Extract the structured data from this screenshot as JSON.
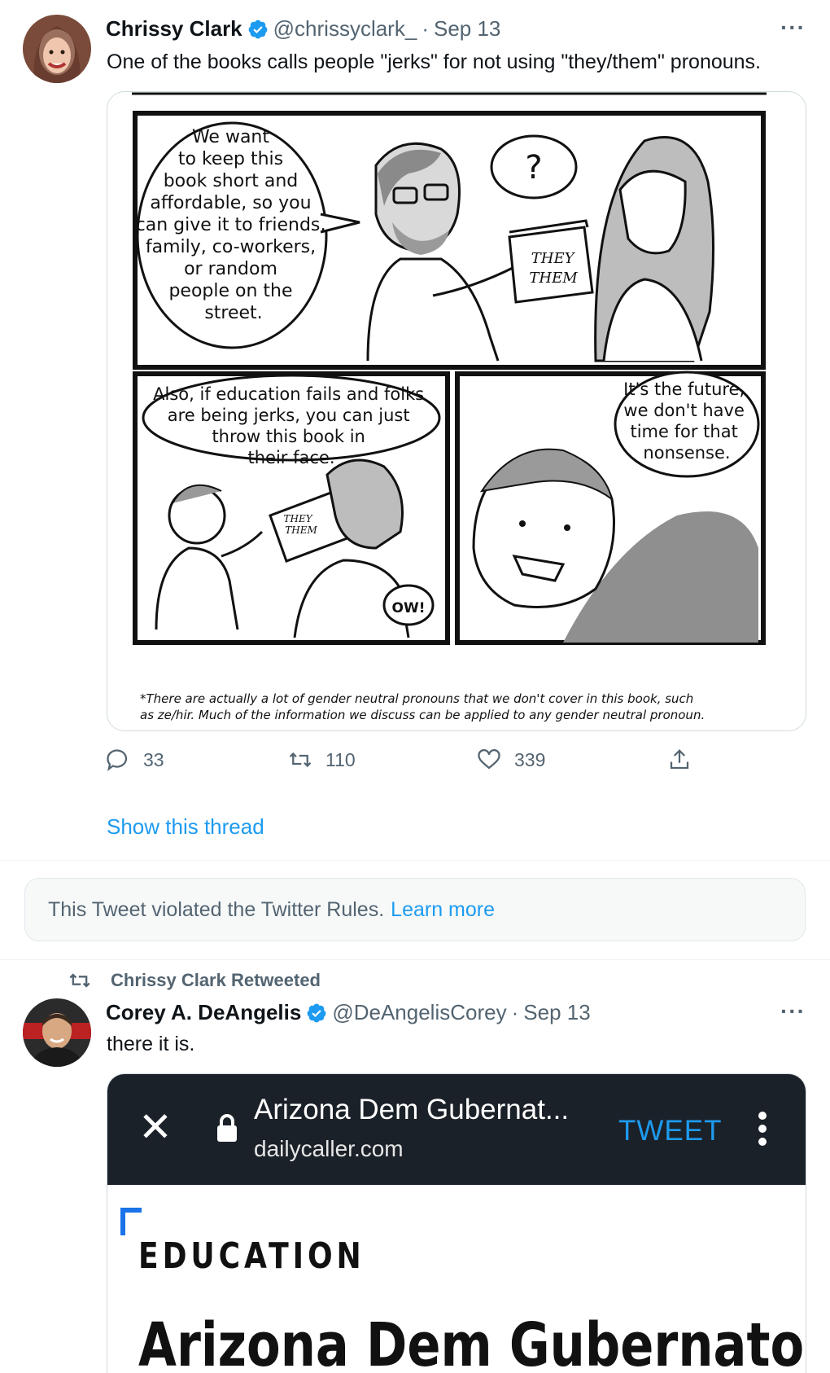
{
  "tweet1": {
    "author_name": "Chrissy Clark",
    "handle": "@chrissyclark_",
    "separator": "·",
    "date": "Sep 13",
    "more": "···",
    "text": "One of the books calls people \"jerks\" for not using \"they/them\" pronouns.",
    "comic": {
      "panel1_bubble": [
        "We want",
        "to keep this",
        "book short and",
        "affordable, so you",
        "can give it to friends,",
        "family, co-workers,",
        "or random",
        "people on the",
        "street."
      ],
      "thought": "?",
      "book_label": [
        "THEY",
        "THEM"
      ],
      "panel2_bubble": [
        "Also, if education fails and folks",
        "are being jerks, you can just",
        "throw this book in",
        "their face."
      ],
      "panel2_book": [
        "THEY",
        "THEM"
      ],
      "panel2_ow": "OW!",
      "panel3_bubble": [
        "It's the future,",
        "we don't have",
        "time for that",
        "nonsense."
      ],
      "footnote": [
        "*There are actually a lot of gender neutral pronouns that we don't cover in this book, such",
        "as ze/hir. Much of the information we discuss can be applied to any gender neutral pronoun."
      ]
    },
    "replies": "33",
    "retweets": "110",
    "likes": "339",
    "show_thread": "Show this thread"
  },
  "violation": {
    "text": "This Tweet violated the Twitter Rules.",
    "link": "Learn more"
  },
  "tweet2": {
    "retweeted_by": "Chrissy Clark Retweeted",
    "author_name": "Corey A. DeAngelis",
    "handle": "@DeAngelisCorey",
    "separator": "·",
    "date": "Sep 13",
    "more": "···",
    "text": "there it is.",
    "screenshot": {
      "close": "✕",
      "page_title": "Arizona Dem Gubernat...",
      "domain": "dailycaller.com",
      "tweet_button": "TWEET",
      "section": "EDUCATION",
      "headline": "Arizona Dem Gubernatorial"
    }
  },
  "colors": {
    "accent": "#1d9bf0",
    "secondary_text": "#536471",
    "phone_bar": "#1b2128"
  },
  "icons": [
    "verified-badge-icon",
    "more-icon",
    "reply-icon",
    "retweet-icon",
    "like-icon",
    "share-icon",
    "lock-icon",
    "close-icon",
    "kebab-menu-icon"
  ]
}
